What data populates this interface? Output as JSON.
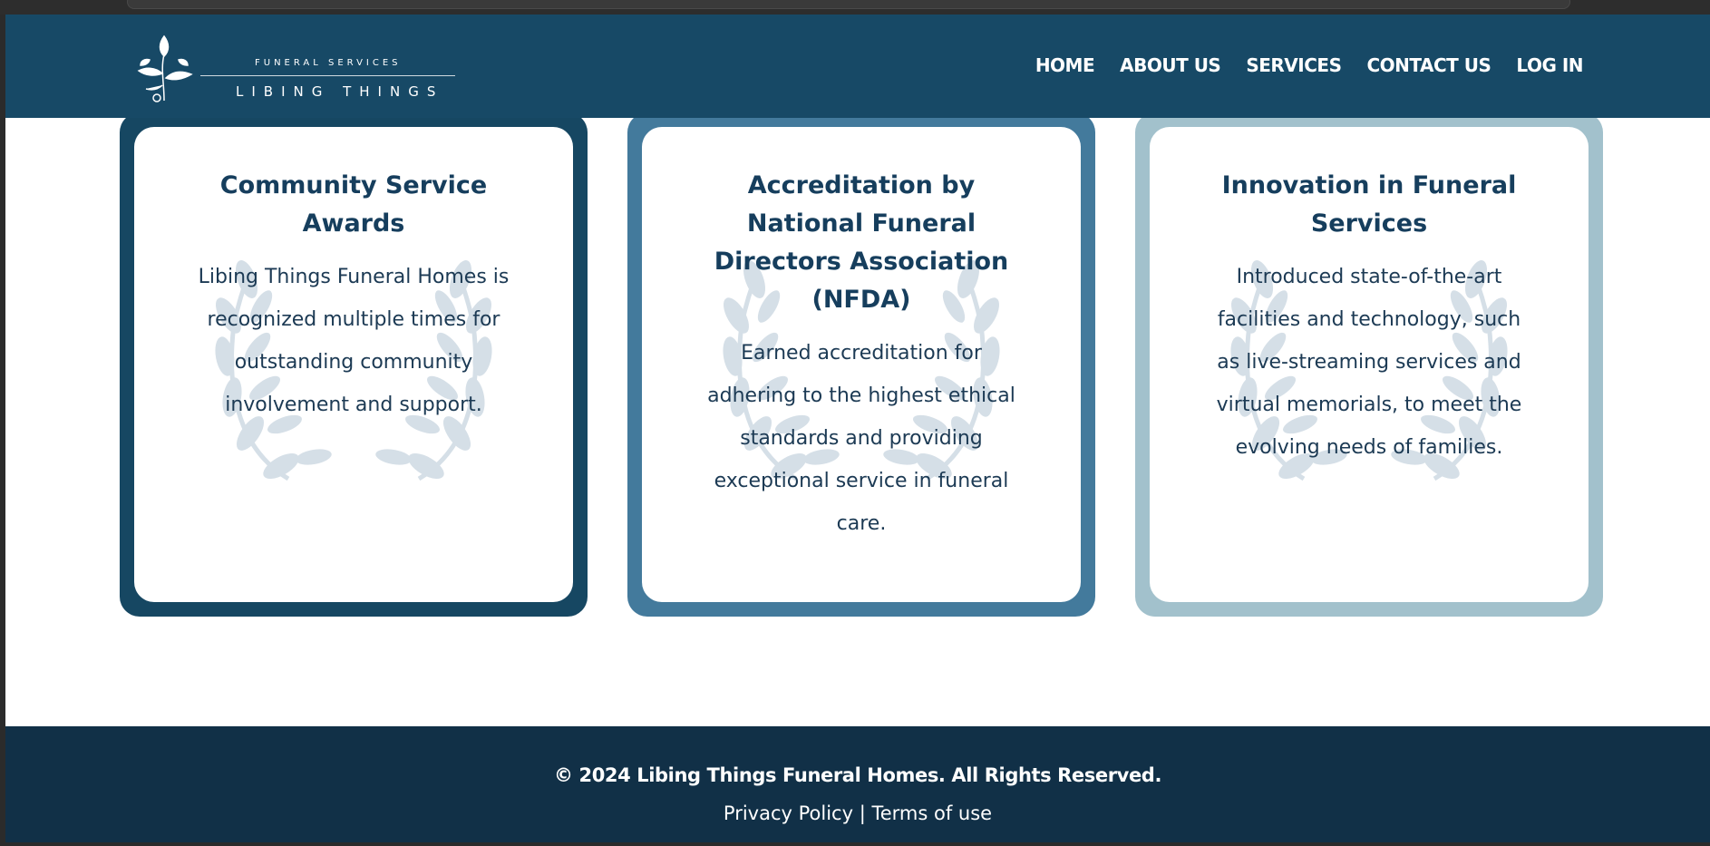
{
  "logo": {
    "small_text": "FUNERAL SERVICES",
    "big_text": "LIBING THINGS"
  },
  "nav": {
    "items": [
      "HOME",
      "ABOUT US",
      "SERVICES",
      "CONTACT US",
      "LOG IN"
    ]
  },
  "cards": [
    {
      "title": "Community Service Awards",
      "text": "Libing Things Funeral Homes is recognized multiple times for outstanding community involvement and support.",
      "border_color": "#164762"
    },
    {
      "title": "Accreditation by National Funeral Directors Association (NFDA)",
      "text": "Earned accreditation for adhering to the highest ethical standards and providing exceptional service in funeral care.",
      "border_color": "#437a9c"
    },
    {
      "title": "Innovation in Funeral Services",
      "text": "Introduced state-of-the-art facilities and technology, such as live-streaming services and virtual memorials, to meet the evolving needs of families.",
      "border_color": "#a2c1cc"
    }
  ],
  "footer": {
    "copyright": "© 2024 Libing Things Funeral Homes. All Rights Reserved.",
    "privacy_label": "Privacy Policy",
    "separator": " | ",
    "terms_label": "Terms of use"
  },
  "colors": {
    "header_bg": "#174966",
    "footer_bg": "#113047",
    "title_text": "#163e5d"
  },
  "icons": {
    "logo": "sprig-leaf-icon",
    "card_background": "laurel-wreath-icon"
  }
}
